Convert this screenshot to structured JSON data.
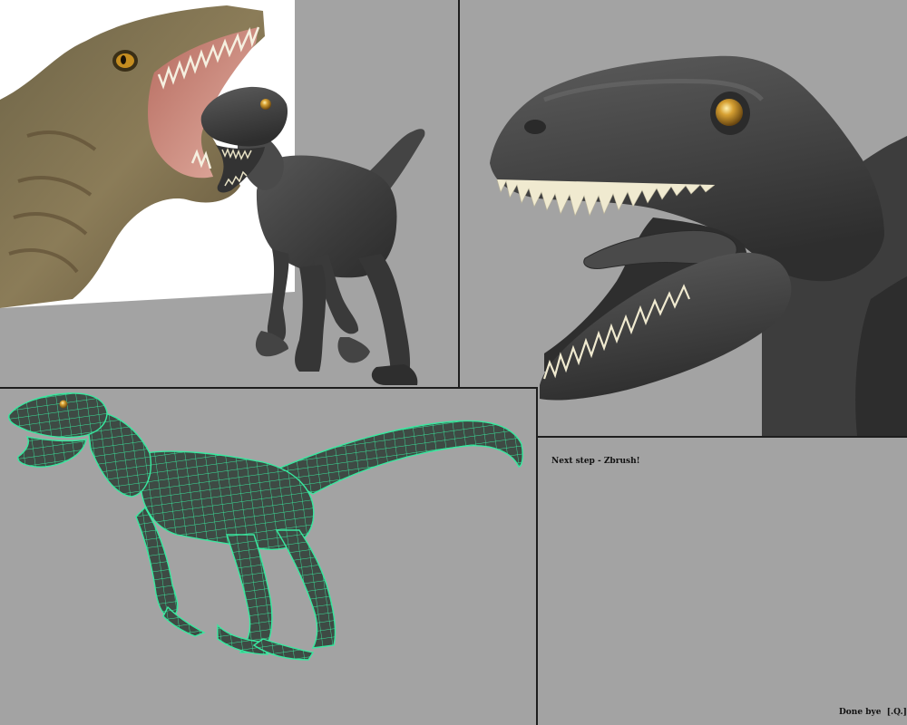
{
  "panels": {
    "reference_panel": {
      "name": "reference-and-model-panel"
    },
    "closeup_panel": {
      "name": "head-closeup-panel"
    },
    "wireframe_panel": {
      "name": "wireframe-panel"
    },
    "notes_panel": {
      "name": "notes-panel"
    }
  },
  "notes": {
    "next_step": "Next step - Zbrush!",
    "credit": "Done bye  [.Q.]"
  },
  "colors": {
    "background": "#a4a4a4",
    "panel_border": "#1e1e1e",
    "model_skin": "#3f3f3f",
    "wire_green": "#35e6a0",
    "eye_amber": "#c2902c",
    "teeth": "#efe9c8",
    "photo_skin": "#8d7a57"
  }
}
